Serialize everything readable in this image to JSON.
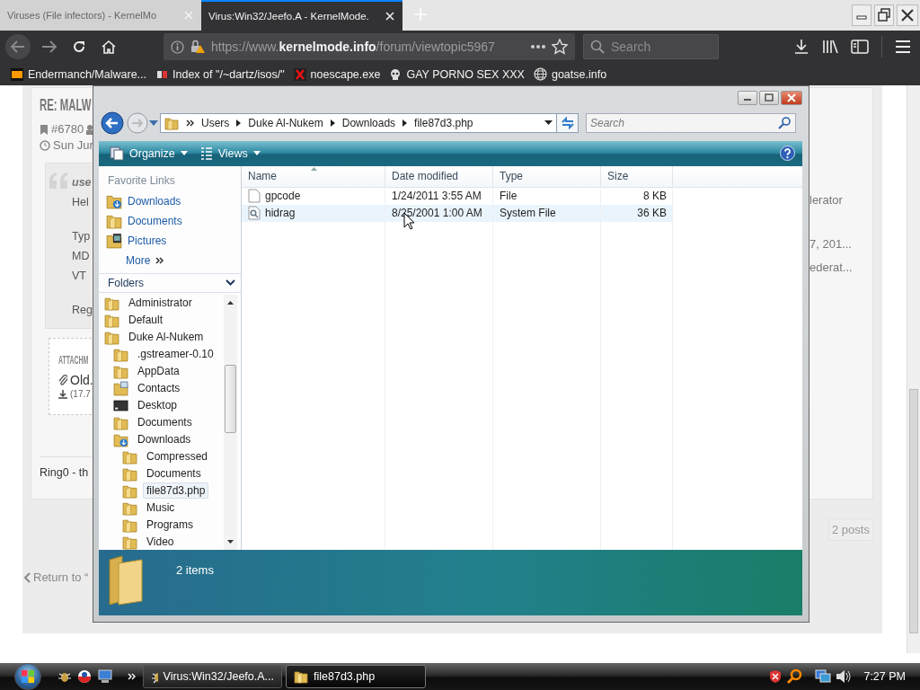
{
  "browser": {
    "tabs": [
      {
        "title": "Viruses (File infectors) - KernelMo",
        "selected": false
      },
      {
        "title": "Virus:Win32/Jeefo.A - KernelMode.",
        "selected": true
      }
    ],
    "url": "https://www.**kernelmode.info**/forum/viewtopic5967",
    "search": {
      "placeholder": "Search"
    },
    "bookmarks": [
      "Endermanch/Malware...",
      "Index of \"/~dartz/isos/\"",
      "noescape.exe",
      "GAY PORNO SEX XXX",
      "goatse.info"
    ]
  },
  "page": {
    "title": "RE: MALW",
    "post_number": "#6780",
    "date": "Sun Jur",
    "quote": {
      "author": "use",
      "paragraphs": [
        [
          "Hel"
        ],
        [
          "Typ",
          "MD",
          "VT"
        ],
        [
          "Reg"
        ]
      ]
    },
    "profile_fragments": [
      "lerator",
      "7, 201...",
      "ederat..."
    ],
    "attachments": {
      "heading": "ATTACHM",
      "file": "Old.",
      "size": "(17.7"
    },
    "signature": "Ring0 - th",
    "pagination": "2 posts",
    "return_link": "Return to “"
  },
  "explorer": {
    "breadcrumb": [
      "Users",
      "Duke Al-Nukem",
      "Downloads",
      "file87d3.php"
    ],
    "search": {
      "placeholder": "Search"
    },
    "toolbar": [
      "Organize",
      "Views"
    ],
    "favorite_links": {
      "heading": "Favorite Links",
      "items": [
        {
          "label": "Downloads",
          "kind": "downloads"
        },
        {
          "label": "Documents",
          "kind": "folder"
        },
        {
          "label": "Pictures",
          "kind": "pictures"
        }
      ],
      "more": "More"
    },
    "folders": {
      "heading": "Folders",
      "tree": [
        {
          "label": "Administrator",
          "kind": "folder",
          "selected": false
        },
        {
          "label": "Default",
          "kind": "folder",
          "selected": false
        },
        {
          "label": "Duke Al-Nukem",
          "kind": "folder",
          "selected": false,
          "children": [
            {
              "label": ".gstreamer-0.10",
              "kind": "folder",
              "selected": false
            },
            {
              "label": "AppData",
              "kind": "folder",
              "selected": false
            },
            {
              "label": "Contacts",
              "kind": "contacts",
              "selected": false
            },
            {
              "label": "Desktop",
              "kind": "desktop",
              "selected": false
            },
            {
              "label": "Documents",
              "kind": "folder",
              "selected": false
            },
            {
              "label": "Downloads",
              "kind": "downloads",
              "selected": false,
              "children": [
                {
                  "label": "Compressed",
                  "kind": "folder",
                  "selected": false
                },
                {
                  "label": "Documents",
                  "kind": "folder",
                  "selected": false
                },
                {
                  "label": "file87d3.php",
                  "kind": "folder",
                  "selected": true
                },
                {
                  "label": "Music",
                  "kind": "folder",
                  "selected": false
                },
                {
                  "label": "Programs",
                  "kind": "folder",
                  "selected": false
                },
                {
                  "label": "Video",
                  "kind": "folder",
                  "selected": false
                }
              ]
            }
          ]
        }
      ]
    },
    "columns": [
      "Name",
      "Date modified",
      "Type",
      "Size"
    ],
    "files": [
      {
        "name": "gpcode",
        "date_modified": "1/24/2011 3:55 AM",
        "type": "File",
        "size": "8 KB",
        "kind": "file",
        "hovered": false
      },
      {
        "name": "hidrag",
        "date_modified": "8/25/2001 1:00 AM",
        "type": "System File",
        "size": "36 KB",
        "kind": "system",
        "hovered": true
      }
    ],
    "details": "2 items"
  },
  "taskbar": {
    "tasks": [
      {
        "label": "Virus:Win32/Jeefo.A...",
        "selected": false
      },
      {
        "label": "file87d3.php",
        "selected": true
      }
    ],
    "clock": "7:27 PM"
  }
}
